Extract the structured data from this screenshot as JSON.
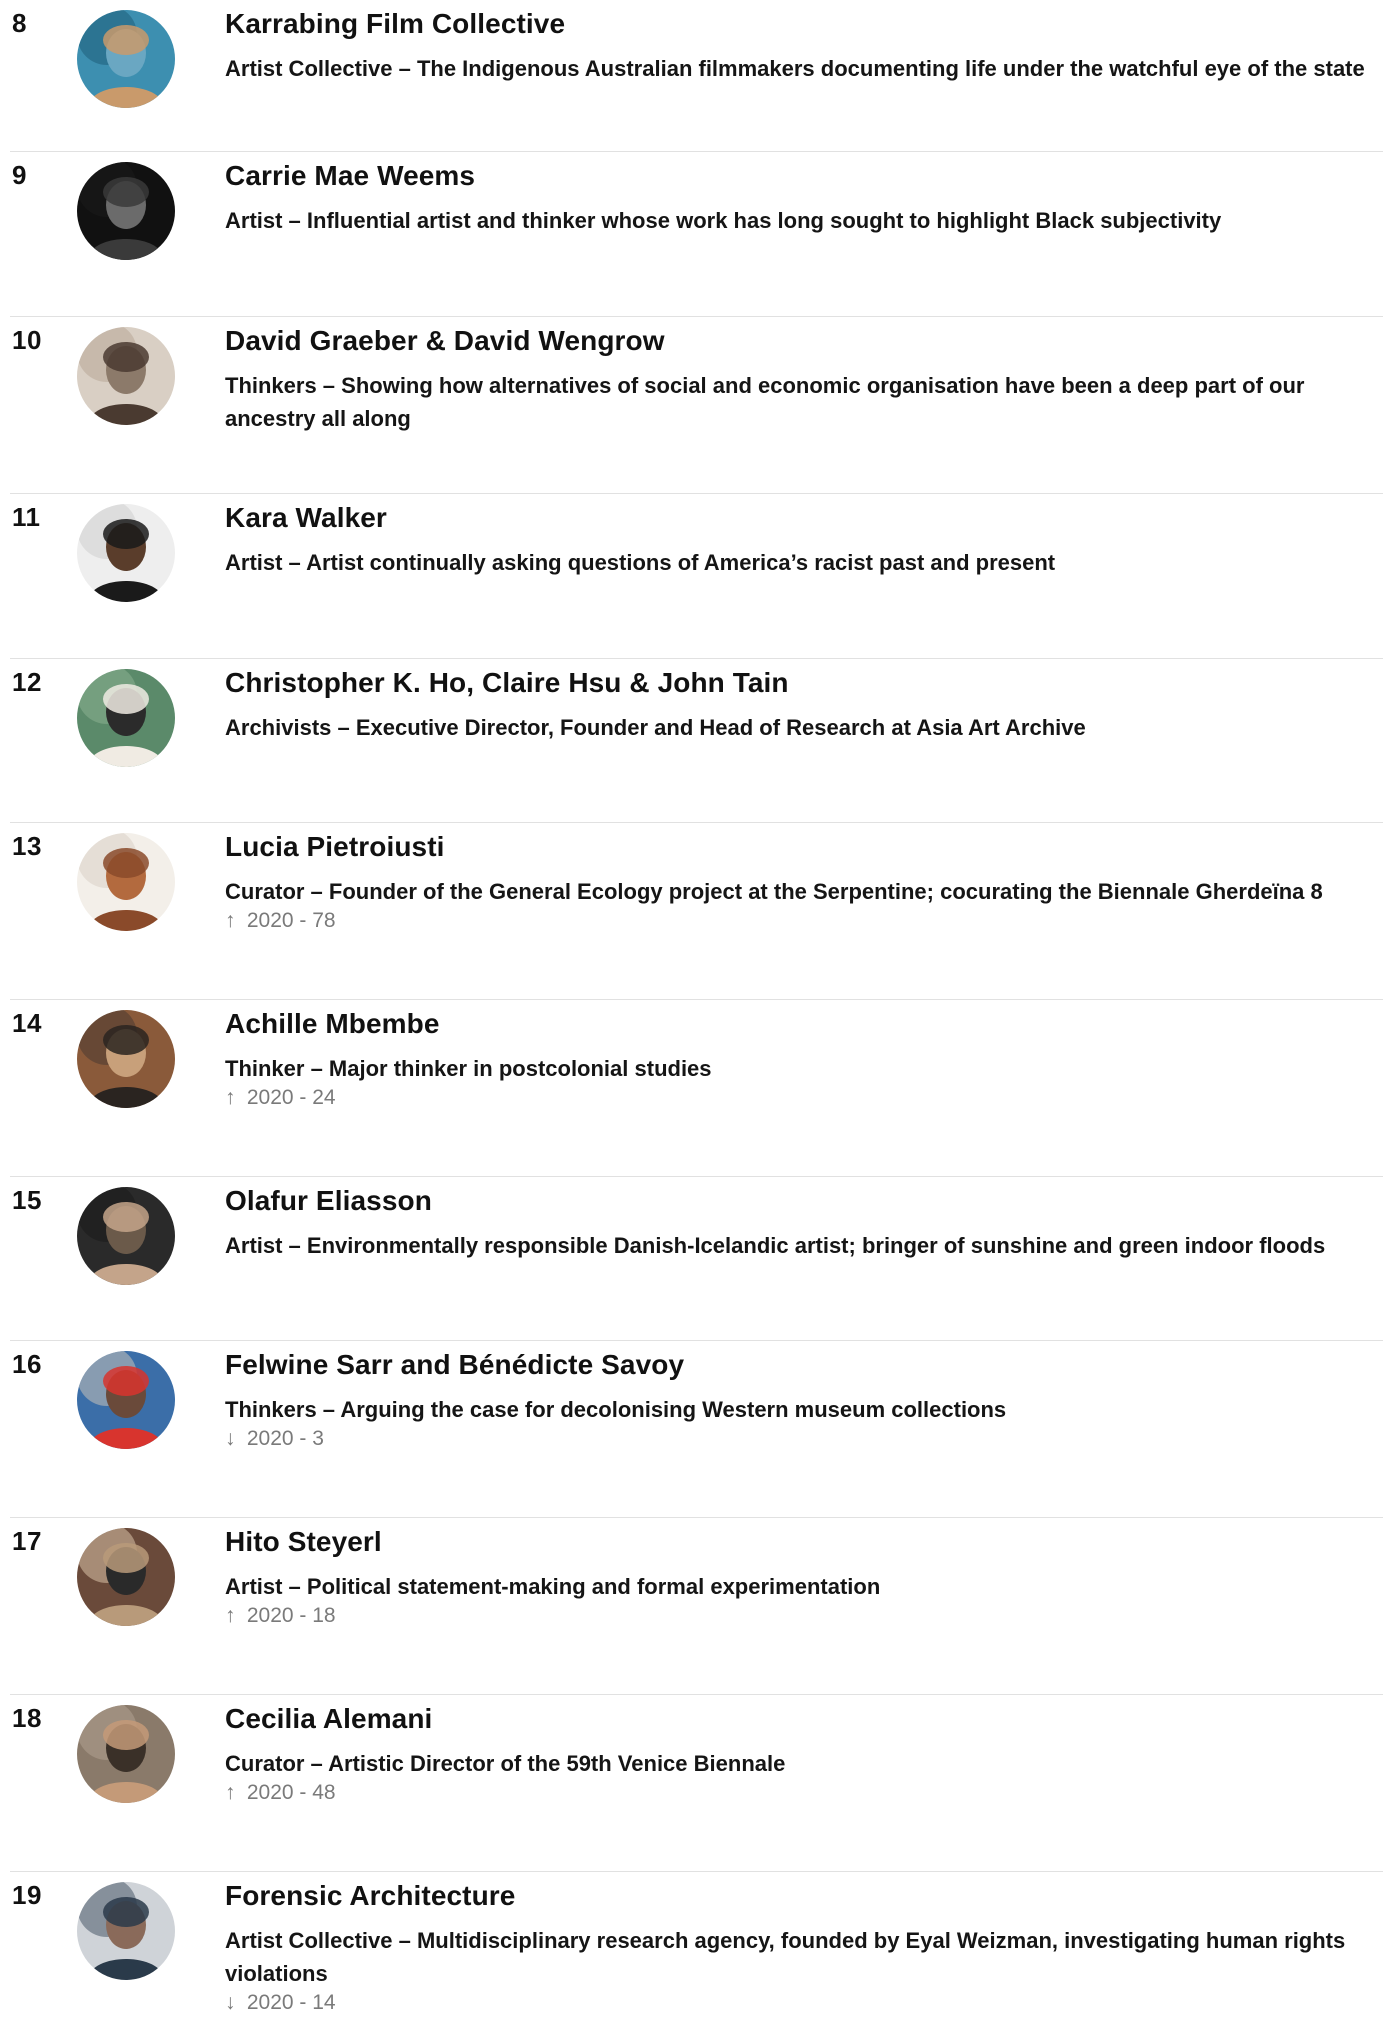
{
  "entries": [
    {
      "rank": "8",
      "name": "Karrabing Film Collective",
      "description": "Artist Collective – The Indigenous Australian filmmakers documenting life under the watchful eye of the state",
      "change": null,
      "avatar_icon": "karrabing-photo"
    },
    {
      "rank": "9",
      "name": "Carrie Mae Weems",
      "description": "Artist – Influential artist and thinker whose work has long sought to highlight Black subjectivity",
      "change": null,
      "avatar_icon": "carrie-mae-weems-portrait"
    },
    {
      "rank": "10",
      "name": "David Graeber & David Wengrow",
      "description": "Thinkers – Showing how alternatives of social and economic organisation have been a deep part of our ancestry all along",
      "change": null,
      "avatar_icon": "graeber-wengrow-portrait"
    },
    {
      "rank": "11",
      "name": "Kara Walker",
      "description": "Artist – Artist continually asking questions of America’s racist past and present",
      "change": null,
      "avatar_icon": "kara-walker-portrait"
    },
    {
      "rank": "12",
      "name": "Christopher K. Ho, Claire Hsu & John Tain",
      "description": "Archivists – Executive Director, Founder and Head of Research at Asia Art Archive",
      "change": null,
      "avatar_icon": "asia-art-archive-portrait"
    },
    {
      "rank": "13",
      "name": "Lucia Pietroiusti",
      "description": "Curator – Founder of the General Ecology project at the Serpentine; cocurating the Biennale Gherdeïna 8",
      "change": {
        "direction": "up",
        "arrow": "↑",
        "text": "2020 - 78"
      },
      "avatar_icon": "lucia-pietroiusti-portrait"
    },
    {
      "rank": "14",
      "name": "Achille Mbembe",
      "description": "Thinker – Major thinker in postcolonial studies",
      "change": {
        "direction": "up",
        "arrow": "↑",
        "text": "2020 - 24"
      },
      "avatar_icon": "achille-mbembe-portrait"
    },
    {
      "rank": "15",
      "name": "Olafur Eliasson",
      "description": "Artist – Environmentally responsible Danish-Icelandic artist; bringer of sunshine and green indoor floods",
      "change": null,
      "avatar_icon": "olafur-eliasson-portrait"
    },
    {
      "rank": "16",
      "name": "Felwine Sarr and Bénédicte Savoy",
      "description": "Thinkers – Arguing the case for decolonising Western museum collections",
      "change": {
        "direction": "down",
        "arrow": "↓",
        "text": "2020 - 3"
      },
      "avatar_icon": "sarr-savoy-portrait"
    },
    {
      "rank": "17",
      "name": "Hito Steyerl",
      "description": "Artist – Political statement-making and formal experimentation",
      "change": {
        "direction": "up",
        "arrow": "↑",
        "text": "2020 - 18"
      },
      "avatar_icon": "hito-steyerl-portrait"
    },
    {
      "rank": "18",
      "name": "Cecilia Alemani",
      "description": "Curator – Artistic Director of the 59th Venice Biennale",
      "change": {
        "direction": "up",
        "arrow": "↑",
        "text": "2020 - 48"
      },
      "avatar_icon": "cecilia-alemani-portrait"
    },
    {
      "rank": "19",
      "name": "Forensic Architecture",
      "description": "Artist Collective – Multidisciplinary research agency, founded by Eyal Weizman, investigating human rights violations",
      "change": {
        "direction": "down",
        "arrow": "↓",
        "text": "2020 - 14"
      },
      "avatar_icon": "forensic-architecture-group-photo"
    }
  ]
}
